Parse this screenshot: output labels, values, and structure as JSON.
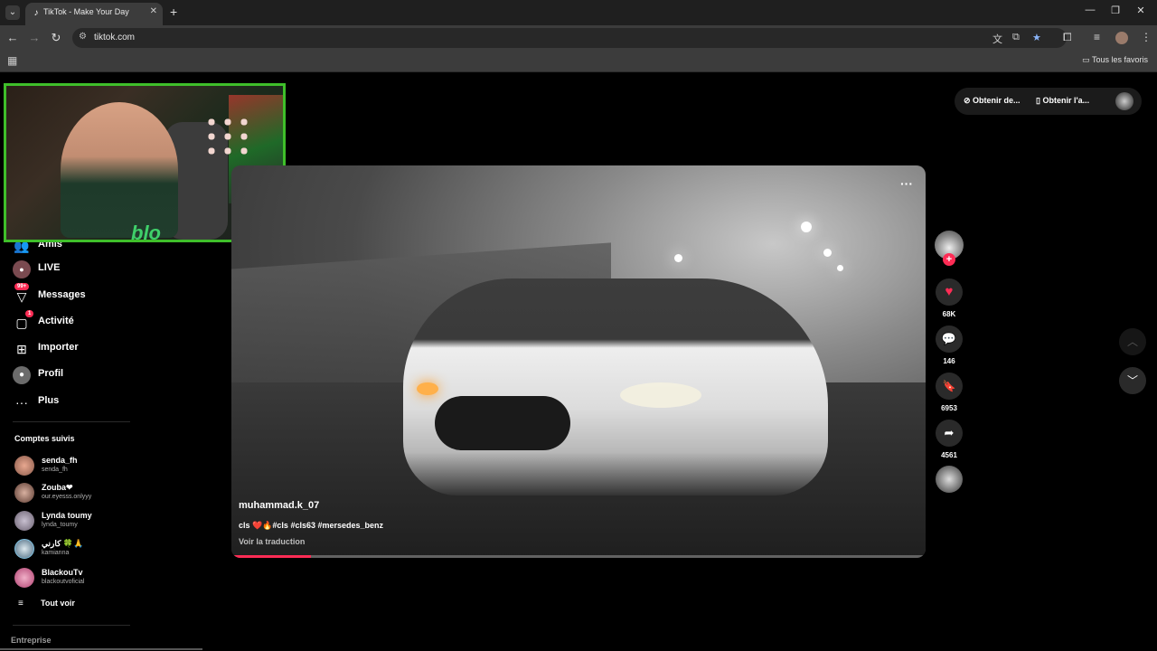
{
  "browser": {
    "tab_title": "TikTok - Make Your Day",
    "url": "tiktok.com",
    "bookmark_folder": "Tous les favoris"
  },
  "top_actions": {
    "get_desktop": "Obtenir de...",
    "get_app": "Obtenir l'a..."
  },
  "sidebar": {
    "items": [
      {
        "label": "Amis",
        "icon": "friends-icon"
      },
      {
        "label": "LIVE",
        "icon": "live-icon"
      },
      {
        "label": "Messages",
        "icon": "messages-icon",
        "badge": "99+"
      },
      {
        "label": "Activité",
        "icon": "activity-icon",
        "badge": "1"
      },
      {
        "label": "Importer",
        "icon": "upload-icon"
      },
      {
        "label": "Profil",
        "icon": "profile-icon"
      },
      {
        "label": "Plus",
        "icon": "more-icon"
      }
    ],
    "following_title": "Comptes suivis",
    "following": [
      {
        "name": "senda_fh",
        "handle": "senda_fh"
      },
      {
        "name": "Zouba❤",
        "handle": "our.eyesss.onlyyy"
      },
      {
        "name": "Lynda toumy",
        "handle": "lynda_toumy"
      },
      {
        "name": "كارني 🍀🙏",
        "handle": "kamianna"
      },
      {
        "name": "BlackouTv",
        "handle": "blackoutvoficial"
      }
    ],
    "see_all": "Tout voir",
    "footer": "Entreprise"
  },
  "video": {
    "author": "muhammad.k_07",
    "caption": "cls ❤️🔥#cls #cls63 #mersedes_benz",
    "translate": "Voir la traduction",
    "progress": 0.115
  },
  "actions": {
    "likes": "68K",
    "comments": "146",
    "saves": "6953",
    "shares": "4561"
  },
  "webcam": {
    "logo": "blo"
  },
  "colors": {
    "accent": "#fe2c55",
    "webcam_border": "#3fbf2a"
  }
}
